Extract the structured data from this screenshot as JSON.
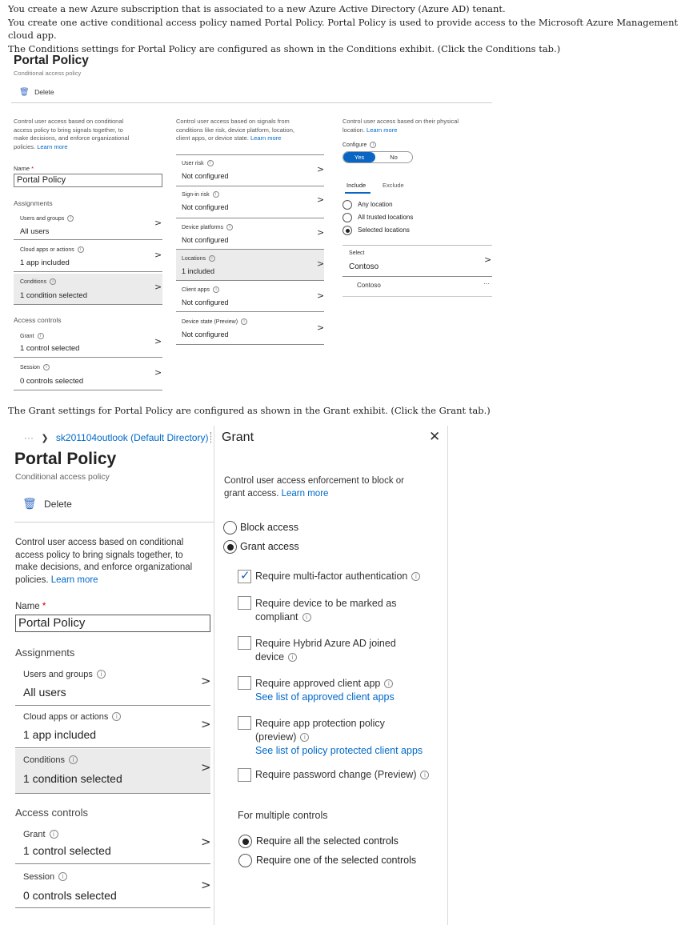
{
  "intro": {
    "line1": "You create a new Azure subscription that is associated to a new Azure Active Directory (Azure AD) tenant.",
    "line2": "You create one active conditional access policy named Portal Policy. Portal Policy is used to provide access to the Microsoft Azure Management cloud app.",
    "line3": "The Conditions settings for Portal Policy are configured as shown in the Conditions exhibit. (Click the Conditions tab.)",
    "line4": "The Grant settings for Portal Policy are configured as shown in the Grant exhibit. (Click the Grant tab.)"
  },
  "exhibit1": {
    "title": "Portal Policy",
    "subtitle": "Conditional access policy",
    "delete_label": "Delete",
    "col1": {
      "desc": [
        "Control user access based on conditional",
        "access policy to bring signals together, to",
        "make decisions, and enforce organizational",
        "policies."
      ],
      "learn_more": "Learn more",
      "name_label": "Name",
      "required_mark": "*",
      "name_value": "Portal Policy",
      "assignments": "Assignments",
      "users_label": "Users and groups",
      "users_value": "All users",
      "cloud_label": "Cloud apps or actions",
      "cloud_value": "1 app included",
      "conditions_label": "Conditions",
      "conditions_value": "1 condition selected",
      "access_controls": "Access controls",
      "grant_label": "Grant",
      "grant_value": "1 control selected",
      "session_label": "Session",
      "session_value": "0 controls selected"
    },
    "col2": {
      "desc": [
        "Control user access based on signals from",
        "conditions like risk, device platform, location,",
        "client apps, or device state."
      ],
      "learn_more": "Learn more",
      "user_risk_label": "User risk",
      "user_risk_value": "Not configured",
      "signin_risk_label": "Sign-in risk",
      "signin_risk_value": "Not configured",
      "device_platforms_label": "Device platforms",
      "device_platforms_value": "Not configured",
      "locations_label": "Locations",
      "locations_value": "1 included",
      "client_apps_label": "Client apps",
      "client_apps_value": "Not configured",
      "device_state_label": "Device state (Preview)",
      "device_state_value": "Not configured"
    },
    "col3": {
      "desc": [
        "Control user access based on their physical",
        "location."
      ],
      "learn_more": "Learn more",
      "configure_label": "Configure",
      "toggle_yes": "Yes",
      "toggle_no": "No",
      "tab_include": "Include",
      "tab_exclude": "Exclude",
      "option_any": "Any location",
      "option_trusted": "All trusted locations",
      "option_selected": "Selected locations",
      "select_label": "Select",
      "select_value": "Contoso",
      "list_item": "Contoso",
      "more": "···"
    }
  },
  "exhibit2": {
    "breadcrumb_dots": "···",
    "breadcrumb_sep": "❯",
    "breadcrumb_link": "sk201104outlook (Default Directory)",
    "title": "Portal Policy",
    "subtitle": "Conditional access policy",
    "delete_label": "Delete",
    "desc": [
      "Control user access based on conditional",
      "access policy to bring signals together, to",
      "make decisions, and enforce organizational",
      "policies."
    ],
    "learn_more": "Learn more",
    "name_label": "Name",
    "required_mark": "*",
    "name_value": "Portal Policy",
    "assignments": "Assignments",
    "users_label": "Users and groups",
    "users_value": "All users",
    "cloud_label": "Cloud apps or actions",
    "cloud_value": "1 app included",
    "conditions_label": "Conditions",
    "conditions_value": "1 condition selected",
    "access_controls": "Access controls",
    "grant_label": "Grant",
    "grant_value": "1 control selected",
    "session_label": "Session",
    "session_value": "0 controls selected",
    "grant_panel": {
      "title": "Grant",
      "close": "✕",
      "desc": [
        "Control user access enforcement to block or",
        "grant access."
      ],
      "learn_more": "Learn more",
      "block_access": "Block access",
      "grant_access": "Grant access",
      "mfa": "Require multi-factor authentication",
      "compliant_1": "Require device to be marked as",
      "compliant_2": "compliant",
      "hybrid_1": "Require Hybrid Azure AD joined",
      "hybrid_2": "device",
      "approved_app": "Require approved client app",
      "approved_link": "See list of approved client apps",
      "app_protection_1": "Require app protection policy",
      "app_protection_2": "(preview)",
      "app_protection_link": "See list of policy protected client apps",
      "password_change": "Require password change (Preview)",
      "multiple_title": "For multiple controls",
      "require_all": "Require all the selected controls",
      "require_one": "Require one of the selected controls"
    }
  },
  "colors": {
    "accent": "#0069c8",
    "toggle_on": "#0a66c2",
    "selected_row": "#ebebeb"
  }
}
